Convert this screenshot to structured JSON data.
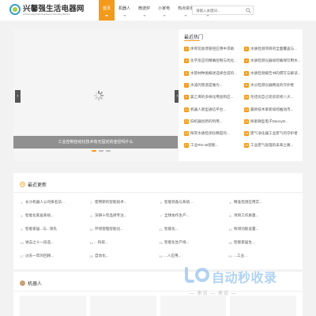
{
  "header": {
    "logo_title": "兴馨强生活电器网",
    "logo_subtitle": "XINGXINQIANGSHENGHUODIANQIWANG",
    "search_placeholder": "请输入关键词...",
    "nav": [
      {
        "label": "首页",
        "active": true
      },
      {
        "label": "机器人",
        "active": false
      },
      {
        "label": "微波炉",
        "active": false
      },
      {
        "label": "小家电",
        "active": false
      },
      {
        "label": "热点资讯",
        "active": false
      },
      {
        "label": "净化器",
        "active": false
      }
    ]
  },
  "slider": {
    "caption": "工业控制自动化技术有无固定的途径吗什么",
    "dots": 3,
    "active_dot": 0
  },
  "hot": {
    "title": "最近热门",
    "items": [
      {
        "num": "1",
        "text": "体育馆会场管控应用中求助"
      },
      {
        "num": "2",
        "text": "水质检测项目的全面覆盖与..."
      },
      {
        "num": "3",
        "text": "化学反应的精确控制与优化..."
      },
      {
        "num": "4",
        "text": "水质检测仪器如何确保饮用水..."
      },
      {
        "num": "5",
        "text": "水管材种类概述选择合适的..."
      },
      {
        "num": "6",
        "text": "水质检测报告书的撰写与解读..."
      },
      {
        "num": "7",
        "text": "水滤的管道是做为..."
      },
      {
        "num": "8",
        "text": "水分检测仪器精准的守护者"
      },
      {
        "num": "9",
        "text": "氯乙烯的多样化用途和应..."
      },
      {
        "num": "10",
        "text": "毛坯房自己装房装修八大..."
      },
      {
        "num": "11",
        "text": "机器人新型通信平台..."
      },
      {
        "num": "12",
        "text": "最新技术革新如何推动市..."
      },
      {
        "num": "13",
        "text": "旧机器创新的利用..."
      },
      {
        "num": "14",
        "text": "探索微型电子DannyD..."
      },
      {
        "num": "15",
        "text": "探究水质检测仪精度的..."
      },
      {
        "num": "16",
        "text": "废气净化器工业废气的守护者"
      },
      {
        "num": "17",
        "text": "工业RN-45智能..."
      },
      {
        "num": "18",
        "text": "工业废气处理的未来之路..."
      }
    ]
  },
  "latest": {
    "title": "最近更新",
    "items": [
      {
        "num": "1",
        "text": "长沙机器人公司排名前..."
      },
      {
        "num": "2",
        "text": "使用新的智能技术..."
      },
      {
        "num": "3",
        "text": "智能装备与系统..."
      },
      {
        "num": "4",
        "text": "精准检测应用实..."
      },
      {
        "num": "5",
        "text": "智能化家居系统..."
      },
      {
        "num": "6",
        "text": "深耕十年品牌专注..."
      },
      {
        "num": "7",
        "text": "全球协作生产..."
      },
      {
        "num": "8",
        "text": "项目工作质量..."
      },
      {
        "num": "9",
        "text": "智能家居...与...领先"
      },
      {
        "num": "10",
        "text": "环境管理智能化..."
      },
      {
        "num": "11",
        "text": "智能化..."
      },
      {
        "num": "12",
        "text": "探测功能设置..."
      },
      {
        "num": "13",
        "text": "进击之十一段选..."
      },
      {
        "num": "14",
        "text": "...科技..."
      },
      {
        "num": "15",
        "text": "智能化生产线..."
      },
      {
        "num": "16",
        "text": "智能家居生..."
      },
      {
        "num": "17",
        "text": "过去一年的回顾..."
      },
      {
        "num": "18",
        "text": "自动化..."
      },
      {
        "num": "19",
        "text": "...人应用..."
      },
      {
        "num": "20",
        "text": "...工业..."
      }
    ]
  },
  "robot_section": {
    "title": "机器人"
  },
  "watermark": {
    "main": "自动秒收录",
    "sub": "— 来访 — 来访 —"
  },
  "colors": {
    "accent": "#f39a1d",
    "brand_green": "#a7cf43",
    "brand_blue": "#3aa0c8"
  }
}
